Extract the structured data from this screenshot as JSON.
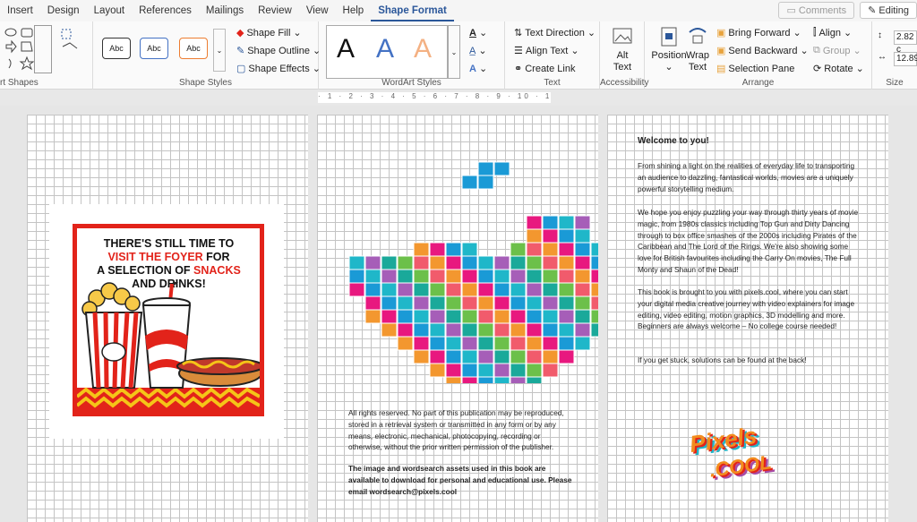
{
  "menu": {
    "tabs": [
      "Insert",
      "Design",
      "Layout",
      "References",
      "Mailings",
      "Review",
      "View",
      "Help",
      "Shape Format"
    ],
    "active": "Shape Format",
    "comments": "Comments",
    "editing": "Editing"
  },
  "ribbon": {
    "insert_shapes_label": "rt Shapes",
    "shape_styles_label": "Shape Styles",
    "abc": "Abc",
    "shape_fill": "Shape Fill",
    "shape_outline": "Shape Outline",
    "shape_effects": "Shape Effects",
    "wordart_label": "WordArt Styles",
    "wordart_letter": "A",
    "text_direction": "Text Direction",
    "align_text": "Align Text",
    "create_link": "Create Link",
    "text_label": "Text",
    "alt_text_1": "Alt",
    "alt_text_2": "Text",
    "accessibility_label": "Accessibility",
    "position": "Position",
    "wrap_text_1": "Wrap",
    "wrap_text_2": "Text",
    "bring_forward": "Bring Forward",
    "send_backward": "Send Backward",
    "selection_pane": "Selection Pane",
    "align": "Align",
    "group": "Group",
    "rotate": "Rotate",
    "arrange_label": "Arrange",
    "size_label": "Size",
    "height": "2.82 c",
    "width": "12.89"
  },
  "ruler": "· 1 · 2 · 3 · 4 · 5 · 6 · 7 · 8 · 9 · 10 · 11 · 12 · 13 · 14 · 15 · 16 · 17 · 18",
  "poster": {
    "line1": "THERE'S STILL TIME TO",
    "line2a": "VISIT THE FOYER",
    "line2b": " FOR",
    "line3a": "A SELECTION OF ",
    "line3b": "SNACKS",
    "line4": "AND DRINKS!"
  },
  "page2": {
    "rights": "All rights reserved. No part of this publication may be reproduced, stored in a retrieval system or transmitted in any form or by any means, electronic, mechanical, photocopying, recording or otherwise, without the prior written permission of the publisher.",
    "assets": "The image and wordsearch assets used in this book are available to download for personal and educational use. Please email wordsearch@pixels.cool"
  },
  "page3": {
    "heading": "Welcome to you!",
    "p1": "From shining a light on the realities of everyday life to transporting an audience to dazzling, fantastical worlds, movies are a uniquely powerful storytelling medium.",
    "p2": "We hope you enjoy puzzling your way through thirty years of movie magic, from 1980s classics including Top Gun and Dirty Dancing through to box office smashes of the 2000s including Pirates of the Caribbean and The Lord of the Rings.  We're also showing some love for British favourites including the Carry On movies, The Full Monty and Shaun of the Dead!",
    "p3": "This book is brought to you with pixels.cool, where you can start your digital media creative journey with video explainers for image editing, video editing, motion graphics, 3D modelling and more.  Beginners are always welcome – No college course needed!",
    "p4": "If you get stuck, solutions can be found at the back!",
    "logo_top": "Pixels",
    "logo_bottom": ".COOL"
  }
}
